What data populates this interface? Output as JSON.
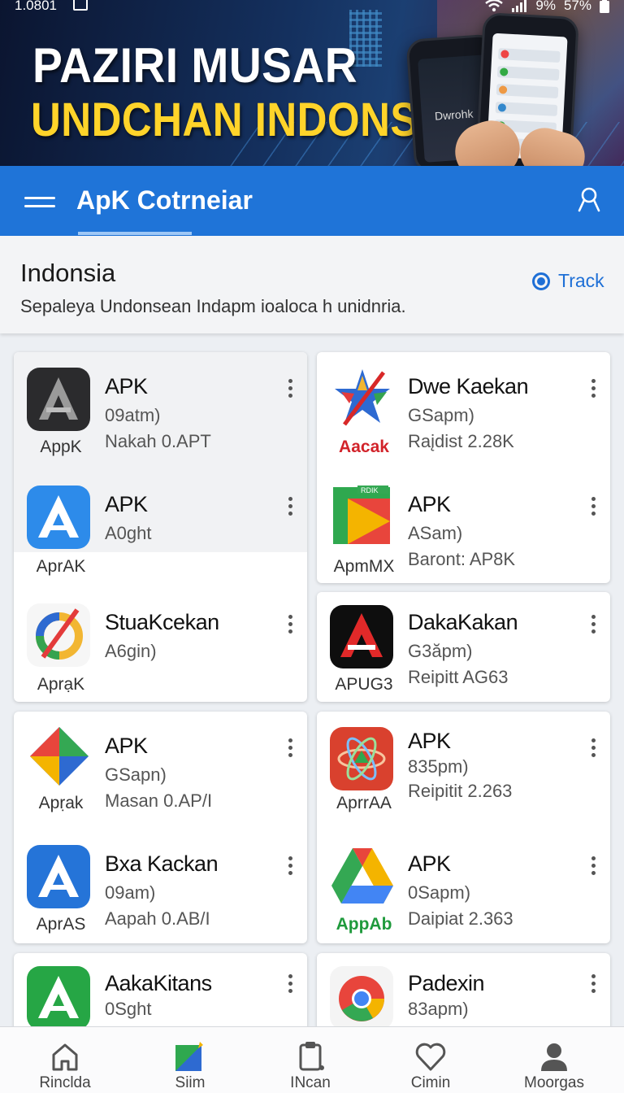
{
  "status_bar": {
    "time": "1.0801",
    "battery_left": "9%",
    "battery_right": "57%"
  },
  "banner": {
    "headline_line1": "PAZIRI MUSAR",
    "headline_line2": "UNDCHAN INDONSIA",
    "phone_text": "Dwrohk",
    "colors": {
      "line2": "#ffd42a"
    }
  },
  "app_bar": {
    "title": "ApK Cotrneiar",
    "color": "#1f74d8"
  },
  "section": {
    "title": "Indonsia",
    "subtitle": "Sepaleya Undonsean Indapm ioaloca h unidnria.",
    "track_label": "Track"
  },
  "apps": [
    {
      "name": "APK",
      "line1": "09atm)",
      "line2": "Nakah 0.APT",
      "caption": "AppK",
      "icon": "apk-dark-icon"
    },
    {
      "name": "Dwe Kaekan",
      "line1": "GSapm)",
      "line2": "Raįdist 2.28K",
      "caption": "Aacak",
      "icon": "colorful-star-icon"
    },
    {
      "name": "APK",
      "line1": "A0ght",
      "line2": "",
      "caption": "AprAK",
      "icon": "apk-blue-icon"
    },
    {
      "name": "APK",
      "line1": "ASam)",
      "line2": "Baront: AP8K",
      "caption": "ApmMX",
      "icon": "play-flag-icon",
      "icon_label": "RDIK"
    },
    {
      "name": "StuaKcekan",
      "line1": "A6gin)",
      "line2": "",
      "caption": "AprạK",
      "icon": "colorful-ring-icon"
    },
    {
      "name": "DakaKakan",
      "line1": "G3ăpm)",
      "line2": "Reipitt AG63",
      "caption": "APUG3",
      "icon": "apk-red-black-icon"
    },
    {
      "name": "APK",
      "line1": "GSapn)",
      "line2": "Masan 0.AP/I",
      "caption": "Apṛak",
      "icon": "google-triangle-icon"
    },
    {
      "name": "APK",
      "line1": "835pm)",
      "line2": "Reipitit 2.263",
      "caption": "AprrAA",
      "icon": "atom-orbit-icon"
    },
    {
      "name": "Bxa Kackan",
      "line1": "09am)",
      "line2": "Aapah 0.AB/I",
      "caption": "AprAS",
      "icon": "apk-blue-icon"
    },
    {
      "name": "APK",
      "line1": "0Sapm)",
      "line2": "Daipiat 2.363",
      "caption": "AppAb",
      "icon": "google-drive-icon"
    },
    {
      "name": "AakaKitans",
      "line1": "0Sght",
      "line2": "",
      "caption": "",
      "icon": "apk-green-icon"
    },
    {
      "name": "Padexin",
      "line1": "83apm)",
      "line2": "",
      "caption": "",
      "icon": "chrome-icon"
    }
  ],
  "bottom_nav": [
    {
      "label": "Rinclda",
      "icon": "home-icon"
    },
    {
      "label": "Siim",
      "icon": "pen-square-icon"
    },
    {
      "label": "INcan",
      "icon": "clipboard-icon"
    },
    {
      "label": "Cimin",
      "icon": "heart-icon"
    },
    {
      "label": "Moorgas",
      "icon": "profile-icon"
    }
  ]
}
